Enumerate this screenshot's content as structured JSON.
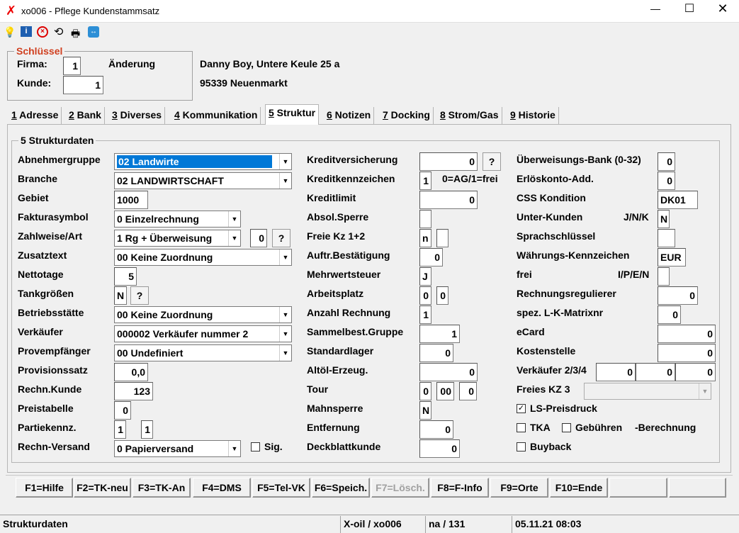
{
  "window": {
    "title": "xo006 - Pflege Kundenstammsatz",
    "icons": [
      "logo-x-icon",
      "minimize-icon",
      "maximize-icon",
      "close-icon"
    ]
  },
  "toolbar": {
    "icons": [
      "lightbulb-icon",
      "info-icon",
      "cancel-icon",
      "refresh-icon",
      "print-icon",
      "remote-icon"
    ]
  },
  "key": {
    "group": "Schlüssel",
    "firma_label": "Firma:",
    "firma_value": "1",
    "kunde_label": "Kunde:",
    "kunde_value": "1",
    "mode": "Änderung",
    "address_line1": "Danny Boy, Untere Keule 25 a",
    "address_line2": "95339 Neuenmarkt"
  },
  "tabs": [
    {
      "num": "1",
      "label": " Adresse"
    },
    {
      "num": "2",
      "label": " Bank"
    },
    {
      "num": "3",
      "label": " Diverses"
    },
    {
      "num": "4",
      "label": " Kommunikation"
    },
    {
      "num": "5",
      "label": " Struktur"
    },
    {
      "num": "6",
      "label": " Notizen"
    },
    {
      "num": "7",
      "label": " Docking"
    },
    {
      "num": "8",
      "label": " Strom/Gas"
    },
    {
      "num": "9",
      "label": " Historie"
    }
  ],
  "section_title": "5 Strukturdaten",
  "left": {
    "abnehmergruppe": {
      "label": "Abnehmergruppe",
      "value": "02 Landwirte"
    },
    "branche": {
      "label": "Branche",
      "value": "02 LANDWIRTSCHAFT"
    },
    "gebiet": {
      "label": "Gebiet",
      "value": "1000"
    },
    "fakturasymbol": {
      "label": "Fakturasymbol",
      "value": "0 Einzelrechnung"
    },
    "zahlweise": {
      "label": "Zahlweise/Art",
      "value": "1 Rg + Überweisung",
      "art": "0"
    },
    "zusatztext": {
      "label": "Zusatztext",
      "value": "00 Keine Zuordnung"
    },
    "nettotage": {
      "label": "Nettotage",
      "value": "5"
    },
    "tankgroessen": {
      "label": "Tankgrößen",
      "value": "N"
    },
    "betriebsstaette": {
      "label": "Betriebsstätte",
      "value": "00 Keine Zuordnung"
    },
    "verkaeufer": {
      "label": "Verkäufer",
      "value": "000002 Verkäufer nummer 2"
    },
    "provempfaenger": {
      "label": "Provempfänger",
      "value": "00 Undefiniert"
    },
    "provisionssatz": {
      "label": "Provisionssatz",
      "value": "0,0"
    },
    "rechn_kunde": {
      "label": "Rechn.Kunde",
      "value": "123"
    },
    "preistabelle": {
      "label": "Preistabelle",
      "value": "0"
    },
    "partiekennz": {
      "label": "Partiekennz.",
      "value1": "1",
      "value2": "1"
    },
    "rechn_versand": {
      "label": "Rechn-Versand",
      "value": "0 Papierversand",
      "sig_label": "Sig."
    }
  },
  "middle": {
    "kreditversicherung": {
      "label": "Kreditversicherung",
      "value": "0"
    },
    "kreditkennzeichen": {
      "label": "Kreditkennzeichen",
      "value": "1",
      "hint": "0=AG/1=frei"
    },
    "kreditlimit": {
      "label": "Kreditlimit",
      "value": "0"
    },
    "absol_sperre": {
      "label": "Absol.Sperre",
      "value": ""
    },
    "freie_kz": {
      "label": "Freie Kz 1+2",
      "value1": "n",
      "value2": ""
    },
    "auftr_bestaetigung": {
      "label": "Auftr.Bestätigung",
      "value": "0"
    },
    "mehrwertsteuer": {
      "label": "Mehrwertsteuer",
      "value": "J"
    },
    "arbeitsplatz": {
      "label": "Arbeitsplatz",
      "value1": "0",
      "value2": "0"
    },
    "anzahl_rechnung": {
      "label": "Anzahl Rechnung",
      "value": "1"
    },
    "sammelbest": {
      "label": "Sammelbest.Gruppe",
      "value": "1"
    },
    "standardlager": {
      "label": "Standardlager",
      "value": "0"
    },
    "altoel": {
      "label": "Altöl-Erzeug.",
      "value": "0"
    },
    "tour": {
      "label": "Tour",
      "value1": "0",
      "value2": "00",
      "value3": "0"
    },
    "mahnsperre": {
      "label": "Mahnsperre",
      "value": "N"
    },
    "entfernung": {
      "label": "Entfernung",
      "value": "0"
    },
    "deckblattkunde": {
      "label": "Deckblattkunde",
      "value": "0"
    }
  },
  "right": {
    "ueberweisungsbank": {
      "label": "Überweisungs-Bank (0-32)",
      "value": "0"
    },
    "erloeskonto": {
      "label": "Erlöskonto-Add.",
      "value": "0"
    },
    "css_kondition": {
      "label": "CSS Kondition",
      "value": "DK01"
    },
    "unter_kunden": {
      "label": "Unter-Kunden",
      "hint": "J/N/K",
      "value": "N"
    },
    "sprachschluessel": {
      "label": "Sprachschlüssel",
      "value": ""
    },
    "waehrung": {
      "label": "Währungs-Kennzeichen",
      "value": "EUR"
    },
    "frei": {
      "label": "frei",
      "hint": "I/P/E/N",
      "value": ""
    },
    "rechnungsregulierer": {
      "label": "Rechnungsregulierer",
      "value": "0"
    },
    "spez_lk": {
      "label": "spez. L-K-Matrixnr",
      "value": "0"
    },
    "ecard": {
      "label": "eCard",
      "value": "0"
    },
    "kostenstelle": {
      "label": "Kostenstelle",
      "value": "0"
    },
    "verkaeufer234": {
      "label": "Verkäufer 2/3/4",
      "value1": "0",
      "value2": "0",
      "value3": "0"
    },
    "freies_kz3": {
      "label": "Freies KZ 3",
      "value": ""
    },
    "ls_preisdruck": {
      "label": "LS-Preisdruck",
      "checked": "✓"
    },
    "tka": {
      "label": "TKA"
    },
    "gebuehren": {
      "label": "Gebühren",
      "suffix": "-Berechnung"
    },
    "buyback": {
      "label": "Buyback"
    }
  },
  "help_button": "?",
  "fkeys": [
    "F1=Hilfe",
    "F2=TK-neu",
    "F3=TK-An",
    "F4=DMS",
    "F5=Tel-VK",
    "F6=Speich.",
    "F7=Lösch.",
    "F8=F-Info",
    "F9=Orte",
    "F10=Ende",
    "",
    ""
  ],
  "status": {
    "left": "Strukturdaten",
    "program": "X-oil / xo006",
    "user": "na / 131",
    "datetime": "05.11.21 08:03"
  }
}
